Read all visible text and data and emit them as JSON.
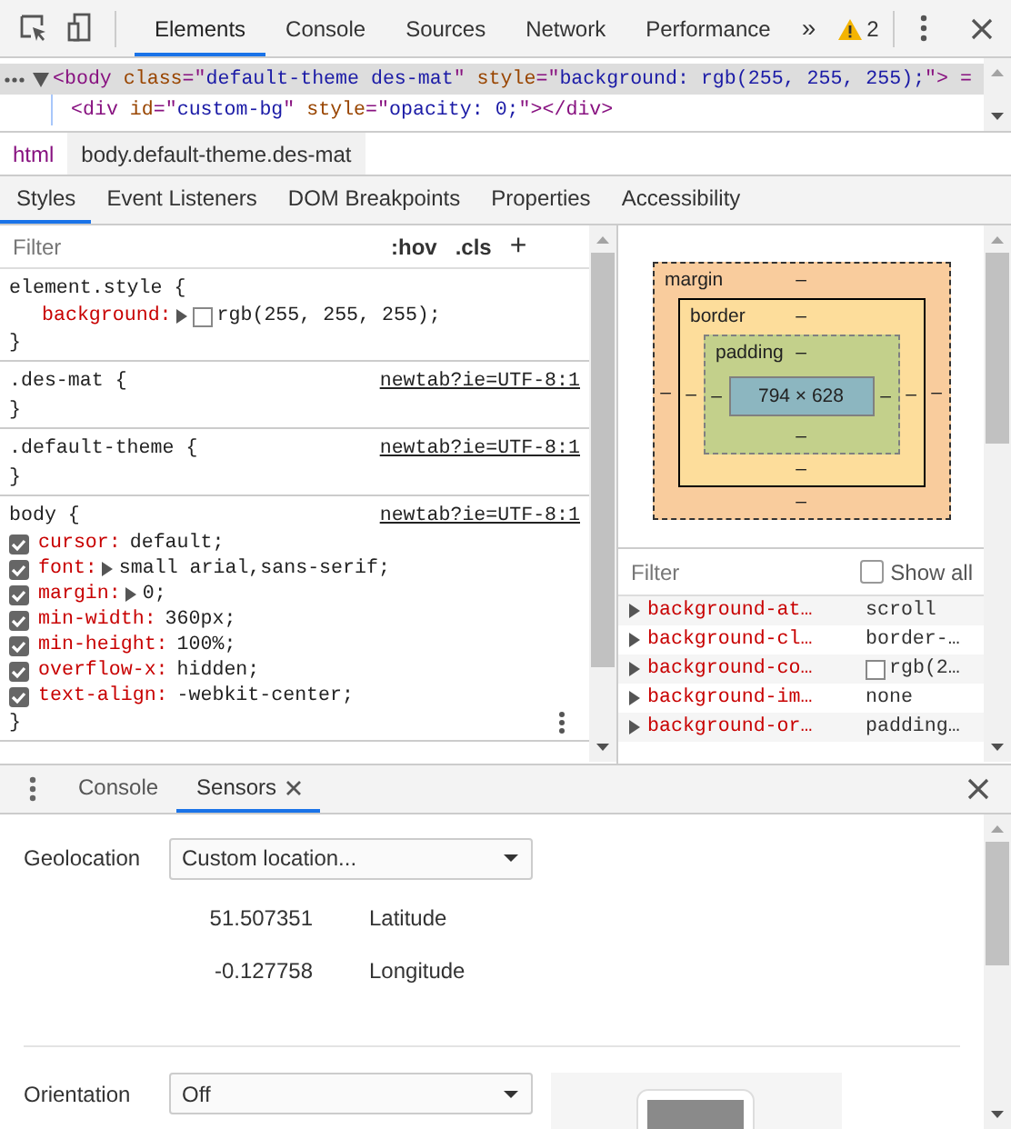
{
  "main_tabs": [
    {
      "label": "Elements",
      "selected": true
    },
    {
      "label": "Console",
      "selected": false
    },
    {
      "label": "Sources",
      "selected": false
    },
    {
      "label": "Network",
      "selected": false
    },
    {
      "label": "Performance",
      "selected": false
    }
  ],
  "more_tabs": "»",
  "warnings": {
    "count": "2"
  },
  "dom_lines": [
    {
      "selected": true,
      "expanded": true,
      "tokens": [
        {
          "kind": "tag",
          "text": "<body"
        },
        {
          "kind": "attr",
          "text": " class"
        },
        {
          "kind": "punct",
          "text": "=\""
        },
        {
          "kind": "value",
          "text": "default-theme des-mat"
        },
        {
          "kind": "punct",
          "text": "\""
        },
        {
          "kind": "attr",
          "text": " style"
        },
        {
          "kind": "punct",
          "text": "=\""
        },
        {
          "kind": "value",
          "text": "background: rgb(255, 255, 255);"
        },
        {
          "kind": "punct",
          "text": "\">"
        },
        {
          "kind": "punct",
          "text": " ="
        }
      ]
    },
    {
      "selected": false,
      "expanded": false,
      "tokens": [
        {
          "kind": "tag",
          "text": "<div"
        },
        {
          "kind": "attr",
          "text": " id"
        },
        {
          "kind": "punct",
          "text": "=\""
        },
        {
          "kind": "value",
          "text": "custom-bg"
        },
        {
          "kind": "punct",
          "text": "\""
        },
        {
          "kind": "attr",
          "text": " style"
        },
        {
          "kind": "punct",
          "text": "=\""
        },
        {
          "kind": "value",
          "text": "opacity: 0;"
        },
        {
          "kind": "punct",
          "text": "\">"
        },
        {
          "kind": "tag",
          "text": "</div>"
        }
      ]
    }
  ],
  "breadcrumbs": [
    {
      "label": "html",
      "selected": false
    },
    {
      "label": "body.default-theme.des-mat",
      "selected": true
    }
  ],
  "sub_tabs": [
    {
      "label": "Styles",
      "selected": true
    },
    {
      "label": "Event Listeners",
      "selected": false
    },
    {
      "label": "DOM Breakpoints",
      "selected": false
    },
    {
      "label": "Properties",
      "selected": false
    },
    {
      "label": "Accessibility",
      "selected": false
    }
  ],
  "styles": {
    "filter": {
      "placeholder": "Filter"
    },
    "buttons": [
      ":hov",
      ".cls",
      "+"
    ],
    "rules": [
      {
        "selector": "element.style {",
        "close": "}",
        "props": [
          {
            "kind": "plain",
            "name": "background:",
            "expandable": true,
            "swatch": true,
            "value": "rgb(255, 255, 255);"
          }
        ]
      },
      {
        "selector": ".des-mat {",
        "source": "newtab?ie=UTF-8:1",
        "close": "}"
      },
      {
        "selector": ".default-theme {",
        "source": "newtab?ie=UTF-8:1",
        "close": "}"
      },
      {
        "selector": "body {",
        "source": "newtab?ie=UTF-8:1",
        "close": "}",
        "props": [
          {
            "kind": "checkbox",
            "checked": true,
            "name": "cursor:",
            "expandable": false,
            "value": "default;"
          },
          {
            "kind": "checkbox",
            "checked": true,
            "name": "font:",
            "expandable": true,
            "value": "small arial,sans-serif;"
          },
          {
            "kind": "checkbox",
            "checked": true,
            "name": "margin:",
            "expandable": true,
            "value": "0;"
          },
          {
            "kind": "checkbox",
            "checked": true,
            "name": "min-width:",
            "expandable": false,
            "value": "360px;"
          },
          {
            "kind": "checkbox",
            "checked": true,
            "name": "min-height:",
            "expandable": false,
            "value": "100%;"
          },
          {
            "kind": "checkbox",
            "checked": true,
            "name": "overflow-x:",
            "expandable": false,
            "value": "hidden;"
          },
          {
            "kind": "checkbox",
            "checked": true,
            "name": "text-align:",
            "expandable": false,
            "value": "-webkit-center;"
          }
        ]
      }
    ]
  },
  "box_model": {
    "margin": {
      "label": "margin",
      "top": "–",
      "left": "–",
      "right": "–",
      "bottom": "–"
    },
    "border": {
      "label": "border",
      "top": "–",
      "left": "–",
      "right": "–",
      "bottom": "–"
    },
    "padding": {
      "label": "padding",
      "top": "–",
      "left": "–",
      "right": "–",
      "bottom": "–"
    },
    "content": "794 × 628"
  },
  "computed": {
    "filter": {
      "placeholder": "Filter"
    },
    "show_all": {
      "label": "Show all",
      "checked": false
    },
    "props": [
      {
        "name": "background-at…",
        "value": "scroll"
      },
      {
        "name": "background-cl…",
        "value": "border-…"
      },
      {
        "name": "background-co…",
        "swatch": true,
        "value": "rgb(2…"
      },
      {
        "name": "background-im…",
        "value": "none"
      },
      {
        "name": "background-or…",
        "value": "padding…"
      }
    ]
  },
  "drawer": {
    "tabs": [
      {
        "label": "Console",
        "selected": false,
        "closable": false
      },
      {
        "label": "Sensors",
        "selected": true,
        "closable": true
      }
    ],
    "geolocation": {
      "label": "Geolocation",
      "value": "Custom location...",
      "coords": [
        {
          "value": "51.507351",
          "label": "Latitude"
        },
        {
          "value": "-0.127758",
          "label": "Longitude"
        }
      ]
    },
    "orientation": {
      "label": "Orientation",
      "value": "Off"
    }
  }
}
